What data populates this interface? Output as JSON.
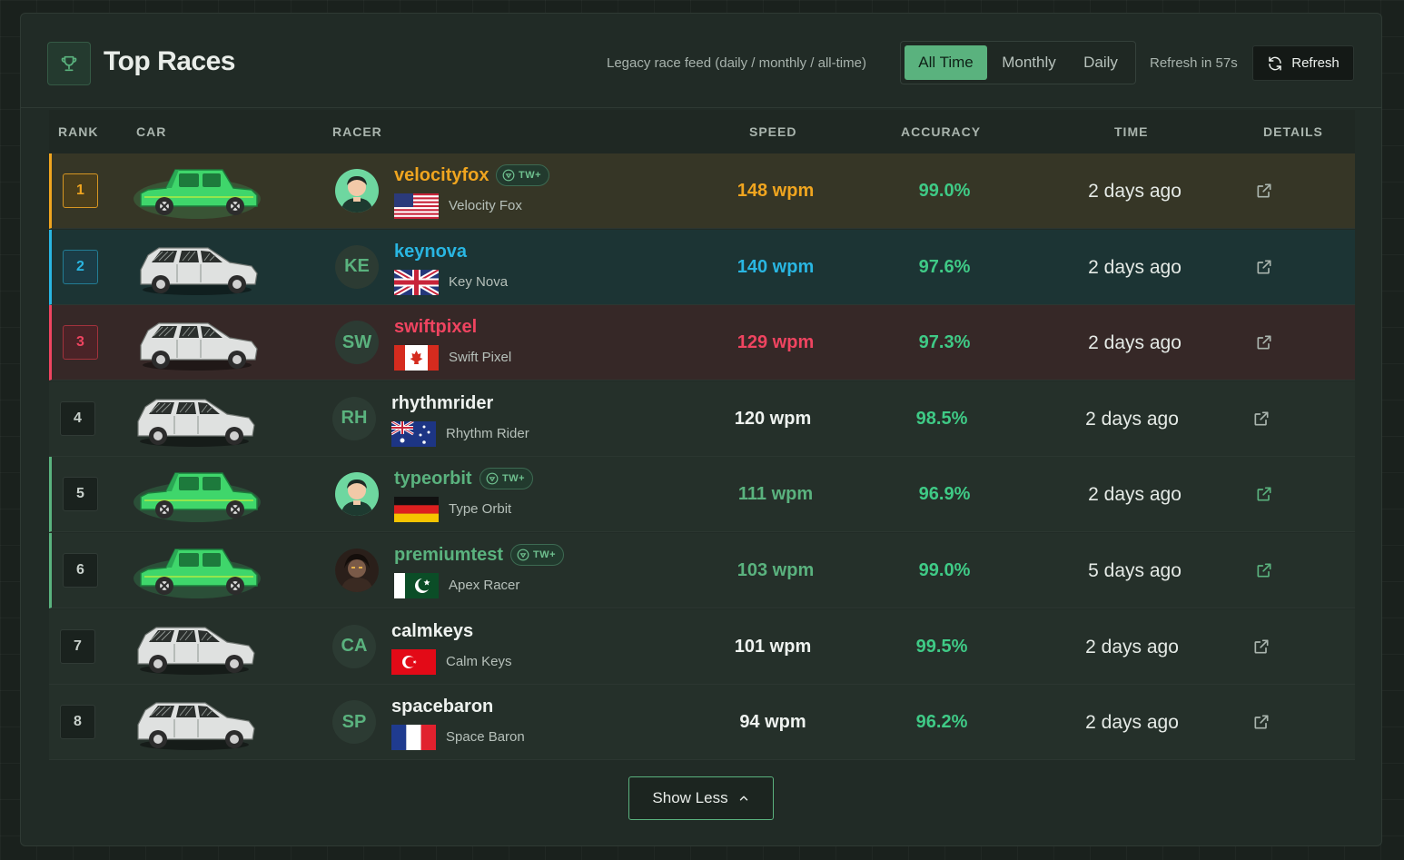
{
  "header": {
    "title": "Top Races",
    "feed_label": "Legacy race feed (daily / monthly / all-time)",
    "tabs": [
      "All Time",
      "Monthly",
      "Daily"
    ],
    "active_tab": "All Time",
    "refresh_in": "Refresh in 57s",
    "refresh_label": "Refresh",
    "trophy_icon": "trophy-icon",
    "refresh_icon": "refresh-icon"
  },
  "columns": {
    "rank": "RANK",
    "car": "CAR",
    "racer": "RACER",
    "speed": "SPEED",
    "accuracy": "ACCURACY",
    "time": "TIME",
    "details": "DETAILS"
  },
  "rows": [
    {
      "rank": "1",
      "username": "velocityfox",
      "badge": "TW+",
      "display_name": "Velocity Fox",
      "flag": "us",
      "avatar": "avatar-image",
      "speed": "148 wpm",
      "accuracy": "99.0%",
      "time": "2 days ago",
      "car": "green-car"
    },
    {
      "rank": "2",
      "username": "keynova",
      "badge": "",
      "display_name": "Key Nova",
      "flag": "gb",
      "avatar": "KE",
      "speed": "140 wpm",
      "accuracy": "97.6%",
      "time": "2 days ago",
      "car": "white-car"
    },
    {
      "rank": "3",
      "username": "swiftpixel",
      "badge": "",
      "display_name": "Swift Pixel",
      "flag": "ca",
      "avatar": "SW",
      "speed": "129 wpm",
      "accuracy": "97.3%",
      "time": "2 days ago",
      "car": "white-car"
    },
    {
      "rank": "4",
      "username": "rhythmrider",
      "badge": "",
      "display_name": "Rhythm Rider",
      "flag": "au",
      "avatar": "RH",
      "speed": "120 wpm",
      "accuracy": "98.5%",
      "time": "2 days ago",
      "car": "white-car"
    },
    {
      "rank": "5",
      "username": "typeorbit",
      "badge": "TW+",
      "display_name": "Type Orbit",
      "flag": "de",
      "avatar": "avatar-image",
      "speed": "111 wpm",
      "accuracy": "96.9%",
      "time": "2 days ago",
      "car": "green-car"
    },
    {
      "rank": "6",
      "username": "premiumtest",
      "badge": "TW+",
      "display_name": "Apex Racer",
      "flag": "pk",
      "avatar": "avatar-photo",
      "speed": "103 wpm",
      "accuracy": "99.0%",
      "time": "5 days ago",
      "car": "green-car"
    },
    {
      "rank": "7",
      "username": "calmkeys",
      "badge": "",
      "display_name": "Calm Keys",
      "flag": "tr",
      "avatar": "CA",
      "speed": "101 wpm",
      "accuracy": "99.5%",
      "time": "2 days ago",
      "car": "white-car"
    },
    {
      "rank": "8",
      "username": "spacebaron",
      "badge": "",
      "display_name": "Space Baron",
      "flag": "fr",
      "avatar": "SP",
      "speed": "94 wpm",
      "accuracy": "96.2%",
      "time": "2 days ago",
      "car": "white-car"
    }
  ],
  "show_less": "Show Less",
  "colors": {
    "gold": "#f0a51f",
    "blue": "#29b6e2",
    "red": "#ef4460",
    "green": "#5ab27e",
    "accuracy": "#3fca86",
    "white_text": "#eef2ef"
  }
}
